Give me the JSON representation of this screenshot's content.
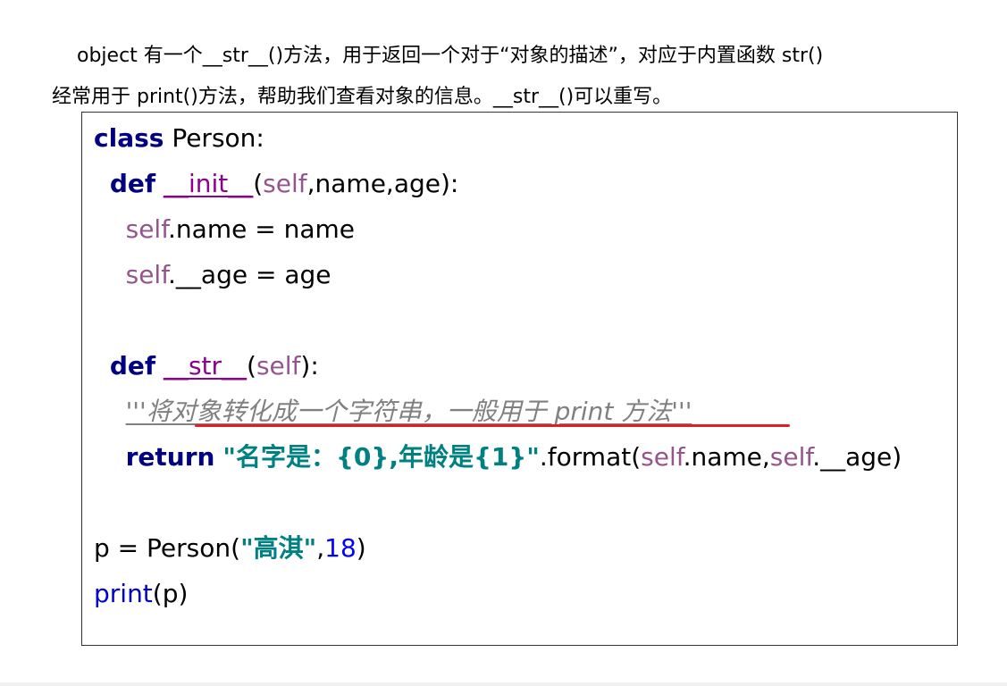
{
  "intro": {
    "line1": "object 有一个__str__()方法，用于返回一个对于“对象的描述”，对应于内置函数 str()",
    "line2": "经常用于 print()方法，帮助我们查看对象的信息。__str__()可以重写。"
  },
  "code": {
    "l1_kw": "class",
    "l1_rest": " Person:",
    "l2_kw": "def",
    "l2_fn": "__init__",
    "l2_open": "(",
    "l2_self": "self",
    "l2_rest": ",name,age):",
    "l3_self": "self",
    "l3_rest": ".name = name",
    "l4_self": "self",
    "l4_rest": ".__age = age",
    "l6_kw": "def",
    "l6_fn": "__str__",
    "l6_open": "(",
    "l6_self": "self",
    "l6_rest": "):",
    "l7_doc": "'''将对象转化成一个字符串，一般用于 print 方法'''",
    "l8_kw": "return",
    "l8_str": "\"名字是：{0},年龄是{1}\"",
    "l8_mid": ".format(",
    "l8_self1": "self",
    "l8_mid2": ".name,",
    "l8_self2": "self",
    "l8_end": ".__age)",
    "l10_a": "p = Person(",
    "l10_str": "\"高淇\"",
    "l10_comma": ",",
    "l10_num": "18",
    "l10_close": ")",
    "l11_fn": "print",
    "l11_rest": "(p)"
  },
  "colors": {
    "keyword": "#000080",
    "self": "#94558d",
    "string": "#008080",
    "number": "#0000ff",
    "docstring": "#808080",
    "highlight_underline": "#e02020"
  }
}
